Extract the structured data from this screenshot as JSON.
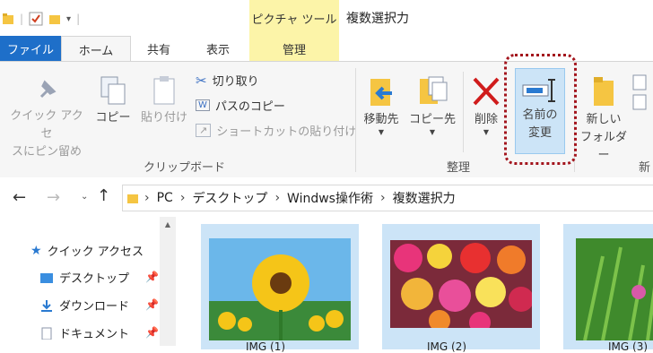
{
  "title_bar": {
    "context_tab_title": "ピクチャ ツール",
    "window_title": "複数選択力"
  },
  "tabs": {
    "file": "ファイル",
    "home": "ホーム",
    "share": "共有",
    "view": "表示",
    "manage": "管理"
  },
  "ribbon": {
    "clipboard": {
      "pin_line1": "クイック アクセ",
      "pin_line2": "スにピン留め",
      "copy": "コピー",
      "paste": "貼り付け",
      "cut": "切り取り",
      "copy_path": "パスのコピー",
      "paste_shortcut": "ショートカットの貼り付け",
      "group_label": "クリップボード"
    },
    "organize": {
      "move_to": "移動先",
      "copy_to": "コピー先",
      "delete": "削除",
      "rename_line1": "名前の",
      "rename_line2": "変更",
      "group_label": "整理"
    },
    "new": {
      "new_folder_line1": "新しい",
      "new_folder_line2": "フォルダー",
      "group_label": "新"
    }
  },
  "address": {
    "path": [
      "PC",
      "デスクトップ",
      "Windws操作術",
      "複数選択力"
    ]
  },
  "nav": {
    "quick_access": "クイック アクセス",
    "items": [
      "デスクトップ",
      "ダウンロード",
      "ドキュメント"
    ]
  },
  "files": [
    {
      "name": "IMG (1)"
    },
    {
      "name": "IMG (2)"
    },
    {
      "name": "IMG (3)"
    }
  ]
}
